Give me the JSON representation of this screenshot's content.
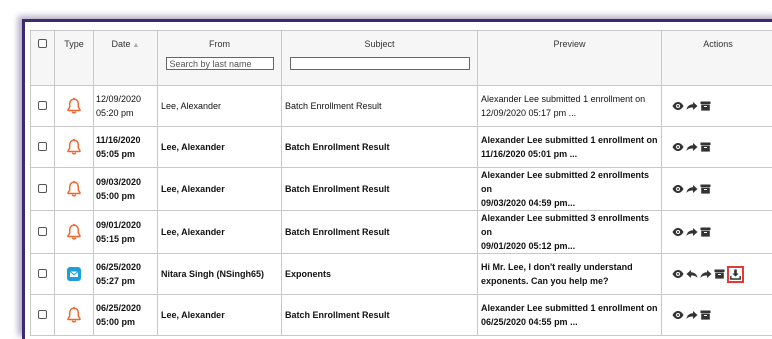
{
  "columns": {
    "type": "Type",
    "date": "Date",
    "from": "From",
    "subject": "Subject",
    "preview": "Preview",
    "actions": "Actions"
  },
  "filters": {
    "from_placeholder": "Search by last name",
    "subject_value": ""
  },
  "colors": {
    "bell": "#f0632a",
    "mail": "#1e9fd8",
    "highlight": "#e53935"
  },
  "rows": [
    {
      "type": "bell-icon",
      "date": "12/09/2020",
      "time": "05:20 pm",
      "from": "Lee, Alexander",
      "subject": "Batch Enrollment Result",
      "preview_1": "Alexander Lee submitted 1 enrollment on",
      "preview_2": "12/09/2020 05:17 pm ...",
      "bold": false
    },
    {
      "type": "bell-icon",
      "date": "11/16/2020",
      "time": "05:05 pm",
      "from": "Lee, Alexander",
      "subject": "Batch Enrollment Result",
      "preview_1": "Alexander Lee submitted 1 enrollment on",
      "preview_2": "11/16/2020 05:01 pm ...",
      "bold": true
    },
    {
      "type": "bell-icon",
      "date": "09/03/2020",
      "time": "05:00 pm",
      "from": "Lee, Alexander",
      "subject": "Batch Enrollment Result",
      "preview_1": "Alexander Lee submitted 2 enrollments on",
      "preview_2": "09/03/2020 04:59 pm...",
      "bold": true
    },
    {
      "type": "bell-icon",
      "date": "09/01/2020",
      "time": "05:15 pm",
      "from": "Lee, Alexander",
      "subject": "Batch Enrollment Result",
      "preview_1": "Alexander Lee submitted 3 enrollments on",
      "preview_2": "09/01/2020 05:12 pm...",
      "bold": true
    },
    {
      "type": "mail-icon",
      "date": "06/25/2020",
      "time": "05:27 pm",
      "from": "Nitara Singh (NSingh65)",
      "subject": "Exponents",
      "preview_1": "Hi Mr. Lee,  I don't really understand",
      "preview_2": "exponents. Can you help me?",
      "bold": true
    },
    {
      "type": "bell-icon",
      "date": "06/25/2020",
      "time": "05:00 pm",
      "from": "Lee, Alexander",
      "subject": "Batch Enrollment Result",
      "preview_1": "Alexander Lee submitted 1 enrollment on",
      "preview_2": "06/25/2020 04:55 pm ...",
      "bold": true
    }
  ]
}
